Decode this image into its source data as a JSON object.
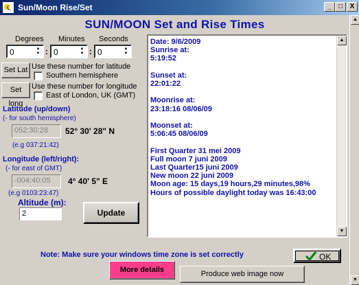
{
  "window": {
    "title": "Sun/Moon Rise/Set",
    "minimize_glyph": "_",
    "maximize_glyph": "□",
    "close_glyph": "X",
    "icon": "sun-moon-icon"
  },
  "heading": "SUN/MOON Set and Rise Times",
  "offset": {
    "degrees_label": "Degrees",
    "minutes_label": "Minutes",
    "seconds_label": "Seconds",
    "degrees": "0",
    "minutes": "0",
    "seconds": "0",
    "separator": ":"
  },
  "set_lat": {
    "button": "Set Lat",
    "text": "Use these number for latitude",
    "checkbox_label": "Southern hemisphere"
  },
  "set_long": {
    "button": "Set long",
    "text": "Use these number for longitude",
    "checkbox_label": "East of London, UK (GMT)"
  },
  "latitude": {
    "title": "Latitude (up/down)",
    "hint": "(- for south hemisphere)",
    "value": "052:30:28",
    "dms": "52° 30' 28\" N",
    "example": "(e.g 037:21:42)"
  },
  "longitude": {
    "title": "Longitude (left/right):",
    "hint": "(- for east of GMT)",
    "value": "-004:40:05",
    "dms": "4° 40' 5\" E",
    "example": "(e.g 0103:23:47)"
  },
  "altitude": {
    "title": "Altitude (m):",
    "value": "2"
  },
  "update_button": "Update",
  "output_lines": [
    "Date: 9/6/2009",
    "Sunrise at:",
    "5:19:52",
    "",
    "Sunset at:",
    "22:01:22",
    "",
    "Moonrise at:",
    "23:18:16 08/06/09",
    "",
    "Moonset at:",
    "5:06:45 08/06/09",
    "",
    "First Quarter  31 mei 2009",
    "Full moon  7 juni 2009",
    "Last Quarter15 juni 2009",
    "New moon 22 juni 2009",
    "Moon age: 15 days,19 hours,29 minutes,98%",
    "Hours of possible daylight today was 16:43:00"
  ],
  "note": "Note: Make sure your windows time zone is set correctly",
  "ok_button": "OK",
  "more_details_button": "More details",
  "web_image_button": "Produce web image now",
  "colors": {
    "accent_text": "#1111aa",
    "more_details_bg": "#ff3d8b",
    "ok_check": "#008000"
  }
}
